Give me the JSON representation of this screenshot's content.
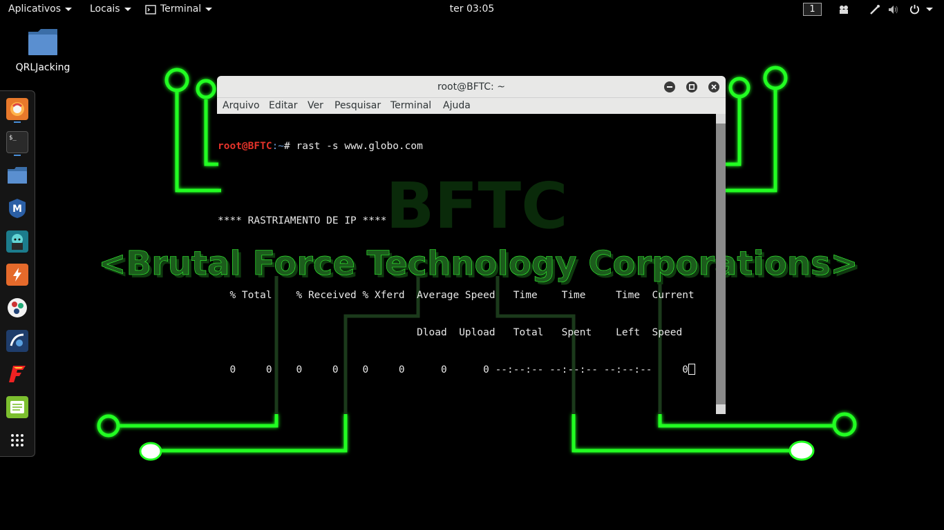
{
  "panel": {
    "applications_label": "Aplicativos",
    "places_label": "Locais",
    "terminal_app_label": "Terminal",
    "clock": "ter 03:05",
    "workspace": "1"
  },
  "desktop": {
    "folder_label": "QRLJacking"
  },
  "wallpaper": {
    "logo_text": "BFTC",
    "tagline": "<Brutal Force Technology Corporations>"
  },
  "dock": {
    "items": [
      {
        "name": "firefox-icon",
        "running": true
      },
      {
        "name": "terminal-icon",
        "running": true
      },
      {
        "name": "files-icon",
        "running": false
      },
      {
        "name": "metasploit-icon",
        "running": false
      },
      {
        "name": "armitage-icon",
        "running": false
      },
      {
        "name": "burpsuite-icon",
        "running": false
      },
      {
        "name": "maltego-icon",
        "running": false
      },
      {
        "name": "beef-icon",
        "running": false
      },
      {
        "name": "faraday-icon",
        "running": false
      },
      {
        "name": "leafpad-icon",
        "running": false
      },
      {
        "name": "show-apps-icon",
        "running": false
      }
    ]
  },
  "terminal": {
    "title": "root@BFTC: ~",
    "menu": [
      "Arquivo",
      "Editar",
      "Ver",
      "Pesquisar",
      "Terminal",
      "Ajuda"
    ],
    "prompt_user": "root@BFTC",
    "prompt_path": ":~",
    "prompt_symbol": "# ",
    "command": "rast -s www.globo.com",
    "heading": "**** RASTRIAMENTO DE IP ****",
    "header1": "  % Total    % Received % Xferd  Average Speed   Time    Time     Time  Current",
    "header2": "                                 Dload  Upload   Total   Spent    Left  Speed",
    "row": "  0     0    0     0    0     0      0      0 --:--:-- --:--:-- --:--:--     0"
  }
}
